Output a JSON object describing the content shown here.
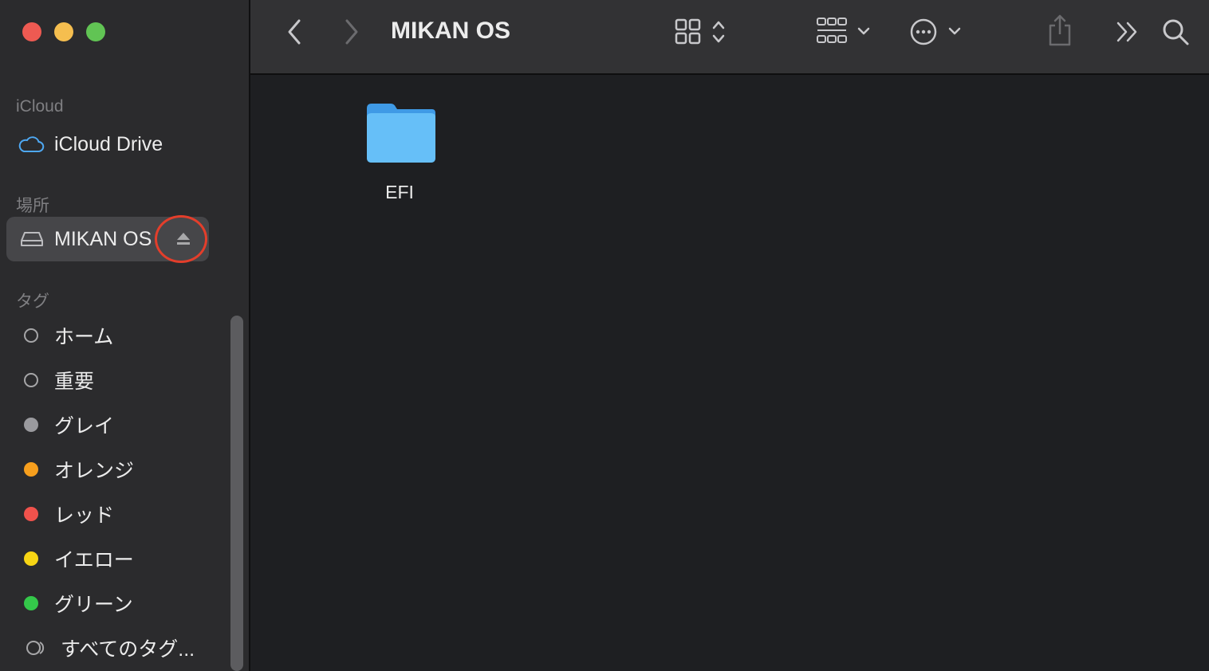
{
  "window": {
    "title": "MIKAN OS"
  },
  "sidebar": {
    "icloud_section": "iCloud",
    "icloud_drive": "iCloud Drive",
    "locations_section": "場所",
    "disk": "MIKAN OS",
    "tags_section": "タグ",
    "tags": [
      {
        "label": "ホーム",
        "color": "none"
      },
      {
        "label": "重要",
        "color": "none"
      },
      {
        "label": "グレイ",
        "color": "#9a9a9e"
      },
      {
        "label": "オレンジ",
        "color": "#f79f1d"
      },
      {
        "label": "レッド",
        "color": "#f0524c"
      },
      {
        "label": "イエロー",
        "color": "#f7d514"
      },
      {
        "label": "グリーン",
        "color": "#34c84a"
      }
    ],
    "all_tags": "すべてのタグ..."
  },
  "files": [
    {
      "name": "EFI",
      "kind": "folder"
    }
  ],
  "colors": {
    "accent_ring": "#e33e2b",
    "folder": "#5ab4f5"
  }
}
